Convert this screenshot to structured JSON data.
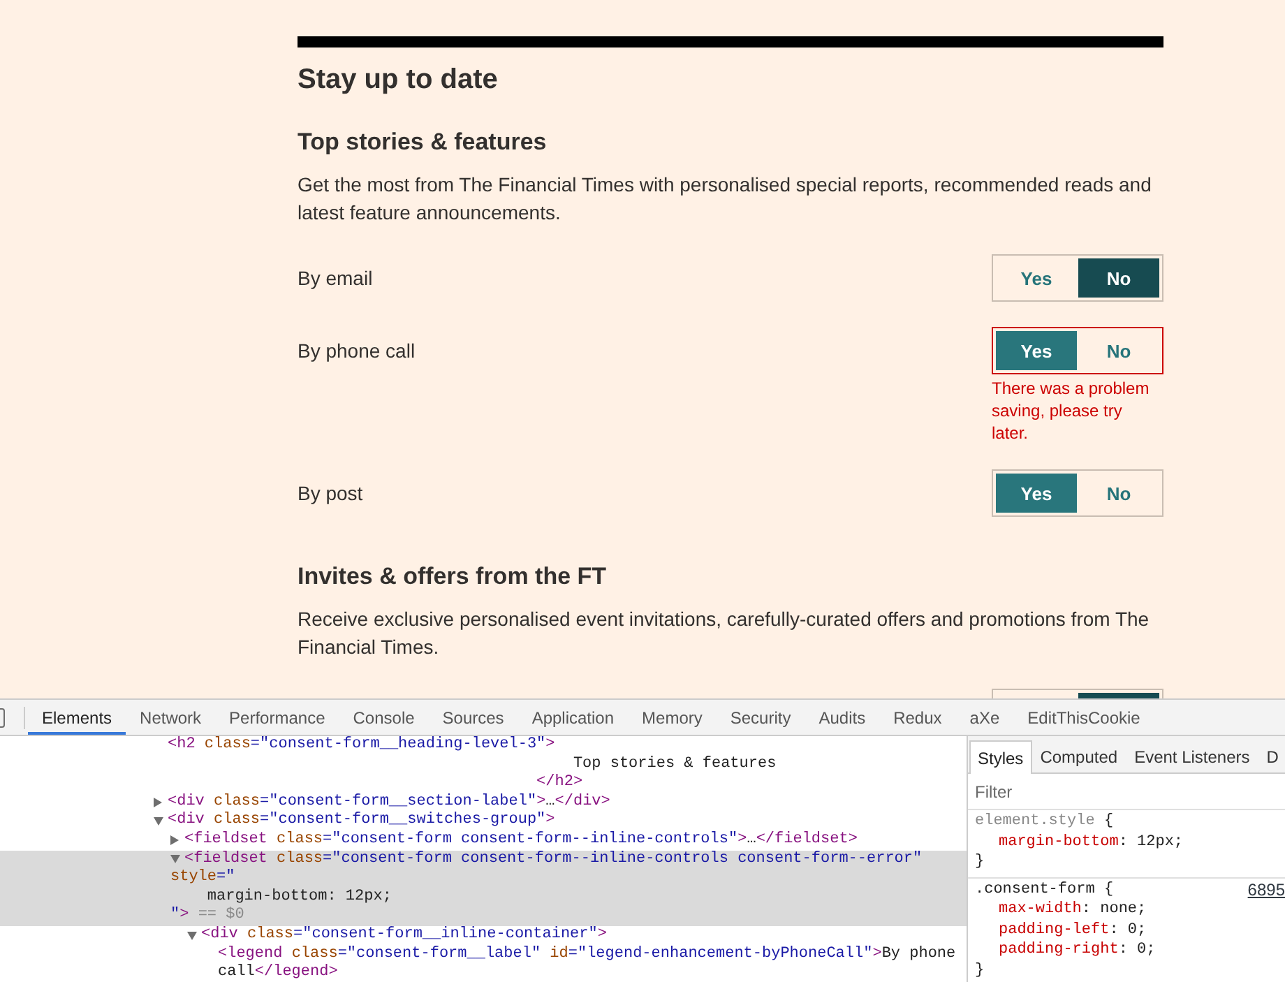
{
  "page": {
    "heading": "Stay up to date",
    "sections": [
      {
        "title": "Top stories & features",
        "description": "Get the most from The Financial Times with personalised special reports, recommended reads and latest feature announcements.",
        "channels": [
          {
            "label": "By email",
            "options": [
              {
                "label": "Yes",
                "selected": false
              },
              {
                "label": "No",
                "selected": true,
                "color": "#174b51"
              }
            ]
          },
          {
            "label": "By phone call",
            "options": [
              {
                "label": "Yes",
                "selected": true,
                "color": "#29767c"
              },
              {
                "label": "No",
                "selected": false
              }
            ],
            "error": "There was a problem saving, please try later."
          },
          {
            "label": "By post",
            "options": [
              {
                "label": "Yes",
                "selected": true,
                "color": "#29767c"
              },
              {
                "label": "No",
                "selected": false
              }
            ]
          }
        ]
      },
      {
        "title": "Invites & offers from the FT",
        "description": "Receive exclusive personalised event invitations, carefully-curated offers and promotions from The Financial Times.",
        "channels": [
          {
            "options": [
              {
                "selected": false
              },
              {
                "selected": true,
                "color": "#174b51"
              }
            ]
          }
        ]
      }
    ]
  },
  "devtools": {
    "tabs": [
      {
        "label": "Elements",
        "selected": true
      },
      {
        "label": "Network",
        "selected": false
      },
      {
        "label": "Performance",
        "selected": false
      },
      {
        "label": "Console",
        "selected": false
      },
      {
        "label": "Sources",
        "selected": false
      },
      {
        "label": "Application",
        "selected": false
      },
      {
        "label": "Memory",
        "selected": false
      },
      {
        "label": "Security",
        "selected": false
      },
      {
        "label": "Audits",
        "selected": false
      },
      {
        "label": "Redux",
        "selected": false
      },
      {
        "label": "aXe",
        "selected": false
      },
      {
        "label": "EditThisCookie",
        "selected": false
      }
    ],
    "dom_tree": [
      {
        "selected": false,
        "lines": [
          [
            {
              "kind": "tag",
              "text": "<h2"
            },
            {
              "kind": "attr",
              "text": " class"
            },
            {
              "kind": "value",
              "text": "=\"consent-form__heading-level-3\""
            },
            {
              "kind": "tag",
              "text": ">"
            }
          ],
          [
            {
              "kind": "text",
              "text": "                                            Top stories & features"
            }
          ],
          [
            {
              "kind": "tag",
              "text": "                                        </h2>"
            }
          ]
        ]
      },
      {
        "expanded": false,
        "selected": false,
        "lines": [
          [
            {
              "kind": "tag",
              "text": "<div"
            },
            {
              "kind": "attr",
              "text": " class"
            },
            {
              "kind": "value",
              "text": "=\"consent-form__section-label\""
            },
            {
              "kind": "tag",
              "text": ">"
            },
            {
              "kind": "text",
              "text": "…"
            },
            {
              "kind": "tag",
              "text": "</div>"
            }
          ]
        ]
      },
      {
        "expanded": true,
        "selected": false,
        "lines": [
          [
            {
              "kind": "tag",
              "text": "<div"
            },
            {
              "kind": "attr",
              "text": " class"
            },
            {
              "kind": "value",
              "text": "=\"consent-form__switches-group\""
            },
            {
              "kind": "tag",
              "text": ">"
            }
          ]
        ],
        "children": [
          {
            "expanded": false,
            "selected": false,
            "lines": [
              [
                {
                  "kind": "tag",
                  "text": "<fieldset"
                },
                {
                  "kind": "attr",
                  "text": " class"
                },
                {
                  "kind": "value",
                  "text": "=\"consent-form consent-form--inline-controls\""
                },
                {
                  "kind": "tag",
                  "text": ">"
                },
                {
                  "kind": "text",
                  "text": "…"
                },
                {
                  "kind": "tag",
                  "text": "</fieldset>"
                }
              ]
            ]
          },
          {
            "expanded": true,
            "selected": true,
            "lines": [
              [
                {
                  "kind": "tag",
                  "text": "<fieldset"
                },
                {
                  "kind": "attr",
                  "text": " class"
                },
                {
                  "kind": "value",
                  "text": "=\"consent-form consent-form--inline-controls consent-form--error\""
                }
              ],
              [
                {
                  "kind": "attr",
                  "text": "style"
                },
                {
                  "kind": "value",
                  "text": "=\""
                }
              ],
              [
                {
                  "kind": "text",
                  "text": "    margin-bottom: 12px;"
                }
              ],
              [
                {
                  "kind": "value",
                  "text": "\""
                },
                {
                  "kind": "tag",
                  "text": ">"
                },
                {
                  "kind": "meta",
                  "text": " == $0"
                }
              ]
            ],
            "children": [
              {
                "expanded": true,
                "selected": false,
                "lines": [
                  [
                    {
                      "kind": "tag",
                      "text": "<div"
                    },
                    {
                      "kind": "attr",
                      "text": " class"
                    },
                    {
                      "kind": "value",
                      "text": "=\"consent-form__inline-container\""
                    },
                    {
                      "kind": "tag",
                      "text": ">"
                    }
                  ]
                ],
                "children": [
                  {
                    "selected": false,
                    "lines": [
                      [
                        {
                          "kind": "tag",
                          "text": "<legend"
                        },
                        {
                          "kind": "attr",
                          "text": " class"
                        },
                        {
                          "kind": "value",
                          "text": "=\"consent-form__label\""
                        },
                        {
                          "kind": "attr",
                          "text": " id"
                        },
                        {
                          "kind": "value",
                          "text": "=\"legend-enhancement-byPhoneCall\""
                        },
                        {
                          "kind": "tag",
                          "text": ">"
                        },
                        {
                          "kind": "text",
                          "text": "By phone"
                        }
                      ],
                      [
                        {
                          "kind": "text",
                          "text": "call"
                        },
                        {
                          "kind": "tag",
                          "text": "</legend>"
                        }
                      ]
                    ]
                  }
                ]
              }
            ]
          }
        ]
      }
    ],
    "sidebar": {
      "tabs": [
        {
          "label": "Styles",
          "selected": true
        },
        {
          "label": "Computed",
          "selected": false
        },
        {
          "label": "Event Listeners",
          "selected": false
        },
        {
          "label": "D",
          "selected": false
        }
      ],
      "filter": {
        "placeholder": "Filter"
      },
      "rules": [
        {
          "kind": "inline",
          "selector": "element.style",
          "open": "{",
          "declarations": [
            {
              "property": "margin-bottom",
              "value": ": 12px;"
            }
          ],
          "close": "}"
        },
        {
          "kind": "class",
          "selector": ".consent-form",
          "open": "{",
          "source": "6895",
          "declarations": [
            {
              "property": "max-width",
              "value": ": none;"
            },
            {
              "property": "padding-left",
              "value": ": 0;"
            },
            {
              "property": "padding-right",
              "value": ": 0;"
            }
          ],
          "close": "}"
        }
      ]
    }
  }
}
